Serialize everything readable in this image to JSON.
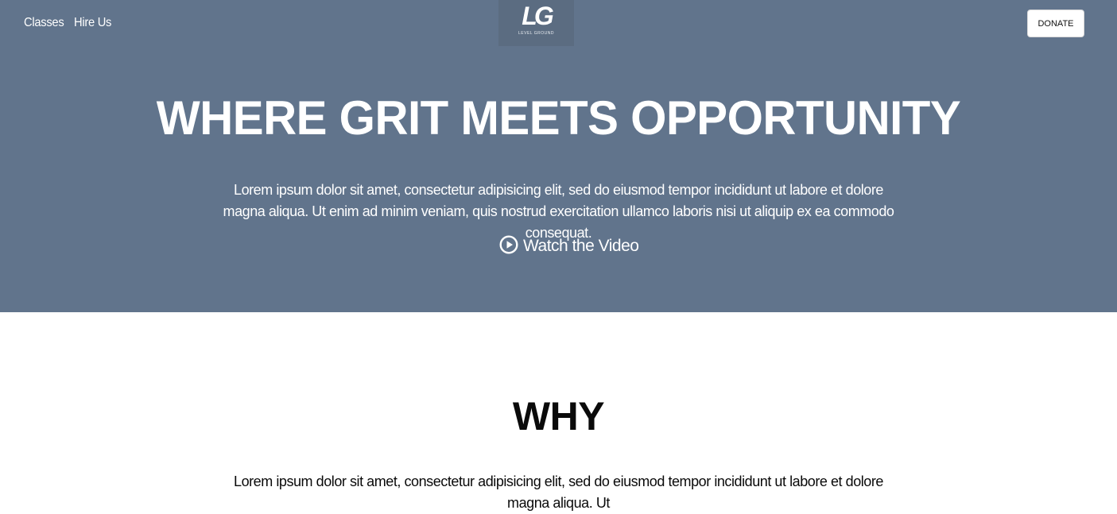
{
  "nav": {
    "classes_label": "Classes",
    "hire_label": "Hire Us",
    "donate_label": "DONATE"
  },
  "logo": {
    "mark": "LG",
    "subtitle": "LEVEL GROUND"
  },
  "hero": {
    "title": "WHERE GRIT MEETS OPPORTUNITY",
    "text": "Lorem ipsum dolor sit amet, consectetur adipisicing elit, sed do eiusmod tempor incididunt ut labore et dolore magna aliqua. Ut enim ad minim veniam, quis nostrud exercitation ullamco laboris nisi ut aliquip ex ea commodo consequat.",
    "watch_label": "Watch the Video",
    "watch_icon": "play-circle-icon"
  },
  "why": {
    "title": "WHY",
    "text": "Lorem ipsum dolor sit amet, consectetur adipisicing elit, sed do eiusmod tempor incididunt ut labore et dolore magna aliqua. Ut"
  },
  "colors": {
    "hero_background": "#61748c",
    "text_light": "#ffffff",
    "text_dark": "#0a0a0a",
    "button_background": "#ffffff"
  }
}
